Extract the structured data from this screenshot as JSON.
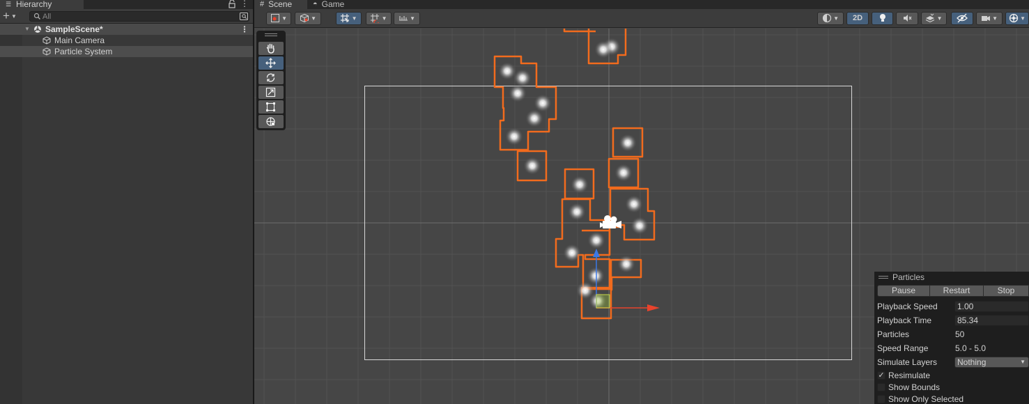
{
  "hierarchy": {
    "tab_title": "Hierarchy",
    "search_placeholder": "All",
    "items": [
      {
        "label": "SampleScene*"
      },
      {
        "label": "Main Camera"
      },
      {
        "label": "Particle System"
      }
    ]
  },
  "scene_view": {
    "tabs": [
      {
        "label": "Scene"
      },
      {
        "label": "Game"
      }
    ],
    "toolbar": {
      "mode_2d_label": "2D"
    }
  },
  "particles": {
    "title": "Particles",
    "buttons": {
      "pause": "Pause",
      "restart": "Restart",
      "stop": "Stop"
    },
    "fields": {
      "playback_speed": {
        "label": "Playback Speed",
        "value": "1.00"
      },
      "playback_time": {
        "label": "Playback Time",
        "value": "85.34"
      },
      "particles": {
        "label": "Particles",
        "value": "50"
      },
      "speed_range": {
        "label": "Speed Range",
        "value": "5.0 - 5.0"
      },
      "simulate_layers": {
        "label": "Simulate Layers",
        "value": "Nothing"
      }
    },
    "checkboxes": {
      "resimulate": {
        "label": "Resimulate",
        "checked": true
      },
      "show_bounds": {
        "label": "Show Bounds",
        "checked": false
      },
      "show_only_selected": {
        "label": "Show Only Selected",
        "checked": false
      }
    }
  },
  "colors": {
    "selection_outline": "#f26b1d",
    "accent_blue": "#46607c",
    "gizmo_x": "#e8432c",
    "gizmo_y": "#3c79e6"
  }
}
